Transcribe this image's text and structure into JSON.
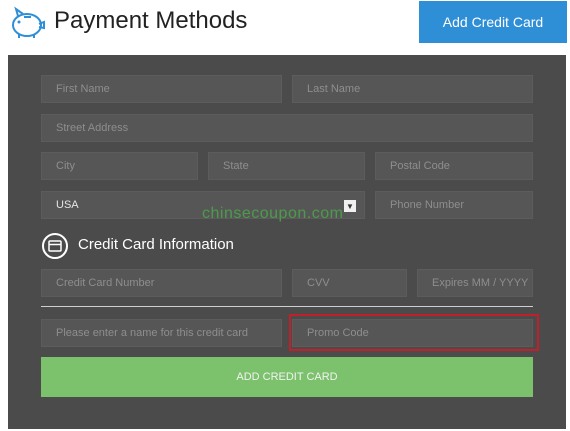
{
  "header": {
    "title": "Payment Methods",
    "add_button": "Add Credit Card"
  },
  "form": {
    "first_name_placeholder": "First Name",
    "last_name_placeholder": "Last Name",
    "street_placeholder": "Street Address",
    "city_placeholder": "City",
    "state_placeholder": "State",
    "postal_placeholder": "Postal Code",
    "country_value": "USA",
    "phone_placeholder": "Phone Number",
    "cc_section_title": "Credit Card Information",
    "card_number_placeholder": "Credit Card Number",
    "cvv_placeholder": "CVV",
    "expires_placeholder": "Expires MM / YYYY",
    "card_name_placeholder": "Please enter a name for this credit card",
    "promo_placeholder": "Promo Code",
    "submit_label": "ADD CREDIT CARD"
  },
  "watermark": "chinsecoupon.com",
  "colors": {
    "accent_blue": "#2f8fd6",
    "panel": "#4b4b4b",
    "submit_green": "#7cc26d",
    "highlight_red": "#c0202a"
  }
}
